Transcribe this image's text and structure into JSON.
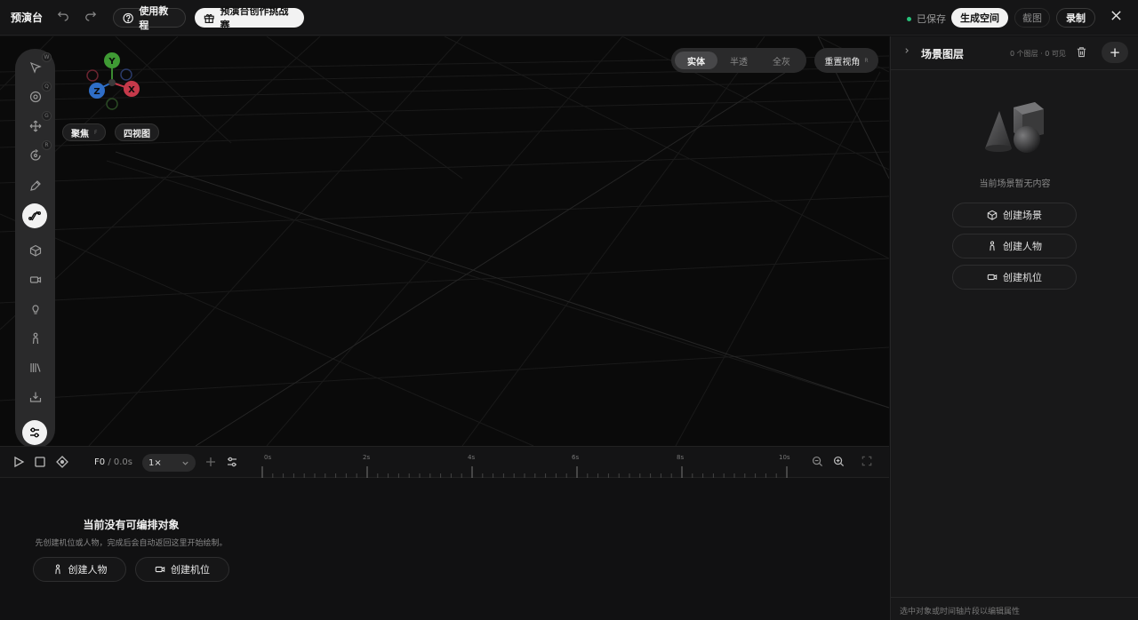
{
  "header": {
    "app_title": "预演台",
    "tutorial_label": "使用教程",
    "challenge_label": "预演台创作挑战赛",
    "saved_label": "已保存",
    "generate_label": "生成空间",
    "screenshot_label": "截图",
    "record_label": "录制",
    "status_color": "#27c27a"
  },
  "toolbar": {
    "key_hints": [
      "W",
      "Q",
      "G",
      "R"
    ]
  },
  "gizmo": {
    "axis_y": "Y",
    "axis_z": "Z",
    "axis_x": "X"
  },
  "viewport": {
    "focus_label": "聚焦",
    "focus_key": "F",
    "four_view_label": "四视图",
    "render_modes": [
      "实体",
      "半透",
      "全灰"
    ],
    "active_mode": "实体",
    "reset_view_label": "重置视角",
    "reset_view_key": "R"
  },
  "timeline": {
    "frame": "F0",
    "separator": "/",
    "time": "0.0s",
    "speed": "1×",
    "ruler_labels": [
      "0s",
      "2s",
      "4s",
      "6s",
      "8s",
      "10s"
    ]
  },
  "empty_state": {
    "title": "当前没有可编排对象",
    "subtitle": "先创建机位或人物，完成后会自动返回这里开始绘制。",
    "create_person": "创建人物",
    "create_camera": "创建机位"
  },
  "scene_panel": {
    "title": "场景图层",
    "count": "0 个图层 · 0 可见",
    "empty_text": "当前场景暂无内容",
    "create_scene": "创建场景",
    "create_person": "创建人物",
    "create_camera": "创建机位",
    "footer_hint": "选中对象或时间轴片段以编辑属性"
  }
}
